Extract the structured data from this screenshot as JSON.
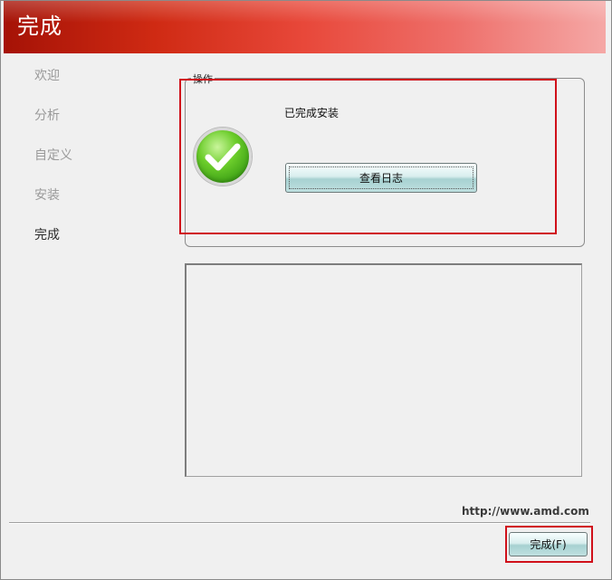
{
  "window": {
    "title": "完成"
  },
  "sidebar": {
    "items": [
      {
        "label": "欢迎",
        "active": false
      },
      {
        "label": "分析",
        "active": false
      },
      {
        "label": "自定义",
        "active": false
      },
      {
        "label": "安装",
        "active": false
      },
      {
        "label": "完成",
        "active": true
      }
    ]
  },
  "operation": {
    "legend": "操作",
    "status": "已完成安装",
    "view_log_label": "查看日志",
    "icon": "success-check-icon"
  },
  "footer": {
    "url": "http://www.amd.com",
    "finish_label": "完成(F)"
  },
  "colors": {
    "header_start": "#a51206",
    "header_end": "#f5a8a6",
    "annotation": "#d0101a",
    "success_green": "#6ccd2b"
  }
}
